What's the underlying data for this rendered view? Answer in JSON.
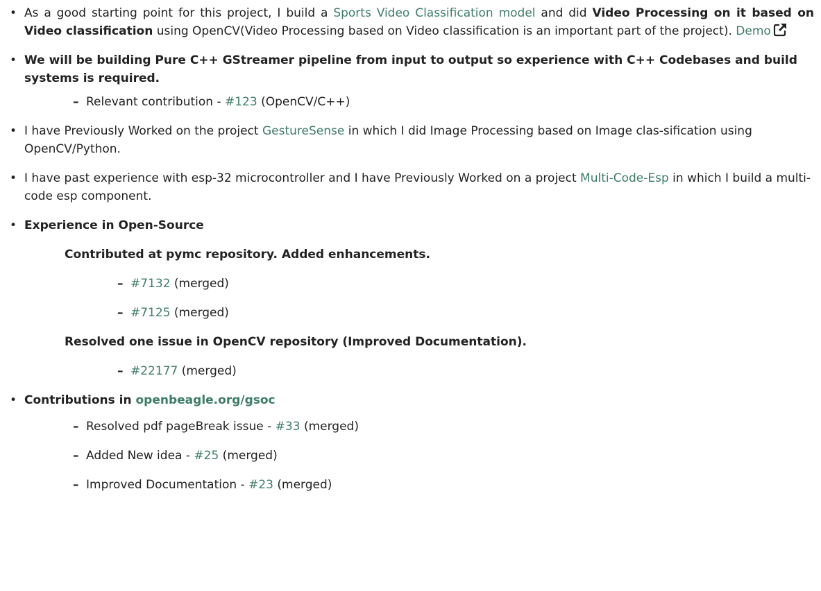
{
  "items": [
    {
      "t1": "As a good starting point for this project, I build a ",
      "link1": "Sports Video Classification model",
      "t2": " and did ",
      "b1": "Video Processing on it based on Video classification",
      "t3": " using OpenCV(Video Processing based on Video classification is an important part of the project). ",
      "link2": "Demo",
      "icon": "external-link-icon"
    },
    {
      "b1": "We will be building Pure C++ GStreamer pipeline from input to output so experience with C++ Codebases and build systems is required.",
      "sub": {
        "t1": "Relevant contribution - ",
        "link": "#123",
        "t2": " (OpenCV/C++)"
      }
    },
    {
      "t1": "I have Previously Worked on the project ",
      "link": "GestureSense",
      "t2": " in which I did Image Processing based on Image clas-sification using OpenCV/Python."
    },
    {
      "t1": "I have past experience with esp-32 microcontroller and I have Previously Worked on a project ",
      "link": "Multi-Code-Esp",
      "t2": " in which I build a multi-code esp component."
    },
    {
      "b1": "Experience in Open-Source",
      "groups": [
        {
          "heading": "Contributed at pymc repository. Added enhancements.",
          "entries": [
            {
              "link": "#7132",
              "t2": " (merged)"
            },
            {
              "link": "#7125",
              "t2": " (merged)"
            }
          ]
        },
        {
          "heading": "Resolved one issue in OpenCV repository (Improved Documentation).",
          "entries": [
            {
              "link": "#22177",
              "t2": " (merged)"
            }
          ]
        }
      ]
    },
    {
      "b1": "Contributions in ",
      "link": "openbeagle.org/gsoc",
      "subs": [
        {
          "t1": "Resolved pdf pageBreak issue - ",
          "link": "#33",
          "t2": " (merged)"
        },
        {
          "t1": "Added New idea - ",
          "link": "#25",
          "t2": " (merged)"
        },
        {
          "t1": "Improved Documentation - ",
          "link": "#23",
          "t2": " (merged)"
        }
      ]
    }
  ],
  "symbols": {
    "bullet": "•",
    "dash": "–"
  }
}
